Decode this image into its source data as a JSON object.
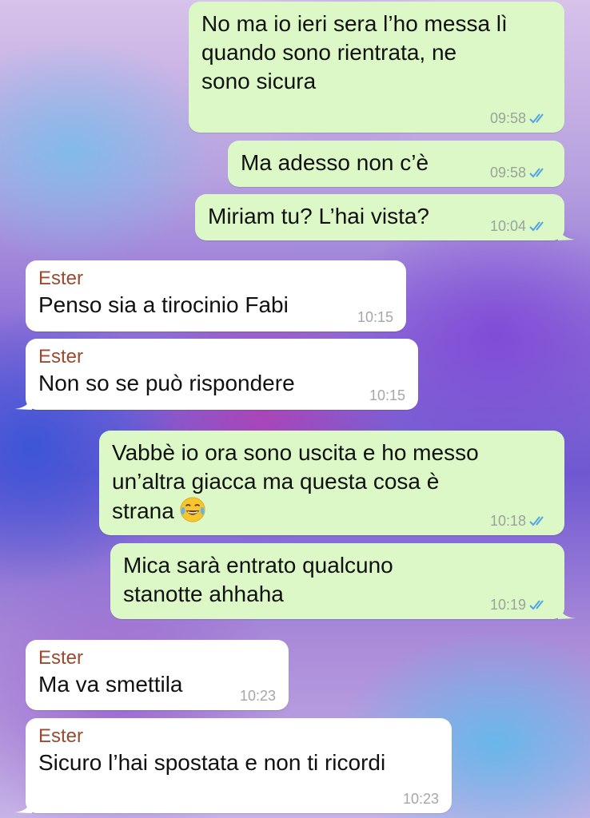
{
  "messages": [
    {
      "direction": "outgoing",
      "sender": "",
      "text": "No ma io ieri sera l’ho messa lì\nquando sono rientrata, ne\nsono sicura",
      "time": "09:58",
      "status": "read",
      "tail": false
    },
    {
      "direction": "outgoing",
      "sender": "",
      "text": "Ma adesso non c’è",
      "time": "09:58",
      "status": "read",
      "tail": false
    },
    {
      "direction": "outgoing",
      "sender": "",
      "text": "Miriam tu? L’hai vista?",
      "time": "10:04",
      "status": "read",
      "tail": true
    },
    {
      "direction": "incoming",
      "sender": "Ester",
      "text": "Penso sia a tirocinio Fabi",
      "time": "10:15",
      "tail": false
    },
    {
      "direction": "incoming",
      "sender": "Ester",
      "text": "Non so se può rispondere",
      "time": "10:15",
      "tail": true
    },
    {
      "direction": "outgoing",
      "sender": "",
      "text": "Vabbè io ora sono uscita e ho messo\nun’altra giacca ma questa cosa è\nstrana",
      "emoji": "face-with-tears-of-joy-emoji",
      "time": "10:18",
      "status": "read",
      "tail": false
    },
    {
      "direction": "outgoing",
      "sender": "",
      "text": "Mica sarà entrato qualcuno\nstanotte ahhaha",
      "time": "10:19",
      "status": "read",
      "tail": true
    },
    {
      "direction": "incoming",
      "sender": "Ester",
      "text": "Ma va smettila",
      "time": "10:23",
      "tail": false
    },
    {
      "direction": "incoming",
      "sender": "Ester",
      "text": "Sicuro l’hai spostata e non ti ricordi",
      "time": "10:23",
      "tail": true
    }
  ],
  "colors": {
    "outgoing_bubble": "#dcf8c6",
    "incoming_bubble": "#ffffff",
    "sender_name": "#9a4a2f",
    "read_ticks": "#4fa3e6"
  },
  "icons": {
    "read_status": "double-check-icon",
    "emoji": "face-with-tears-of-joy-emoji"
  }
}
